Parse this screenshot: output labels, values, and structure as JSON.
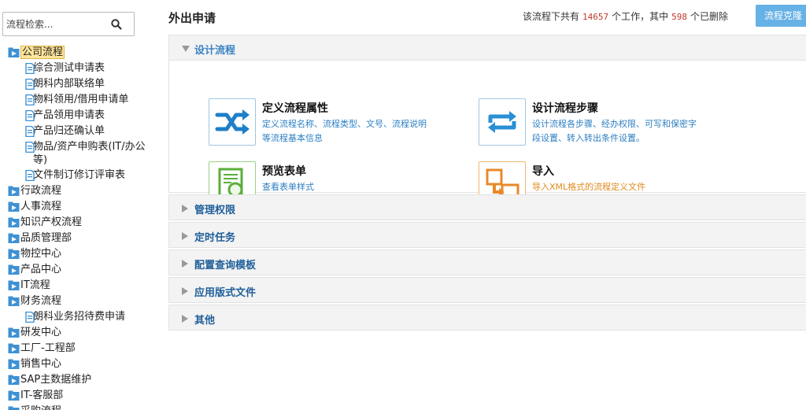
{
  "search": {
    "placeholder": "流程检索..."
  },
  "tree": {
    "root": "公司流程",
    "root_children": [
      "综合测试申请表",
      "朗科内部联络单",
      "物料领用/借用申请单",
      "产品领用申请表",
      "产品归还确认单",
      "物品/资产申购表(IT/办公等)",
      "文件制订修订评审表"
    ],
    "groups_a": [
      "行政流程",
      "人事流程",
      "知识产权流程",
      "品质管理部",
      "物控中心",
      "产品中心",
      "IT流程",
      "财务流程"
    ],
    "finance_child": "朗科业务招待费申请",
    "groups_b": [
      "研发中心",
      "工厂-工程部",
      "销售中心",
      "SAP主数据维护",
      "IT-客服部",
      "采购流程"
    ]
  },
  "header": {
    "title": "外出申请",
    "stats_prefix": "该流程下共有",
    "work_count": "14657",
    "stats_middle": "个工作，其中",
    "deleted_count": "598",
    "stats_suffix": "个已删除",
    "clone_button": "流程克隆"
  },
  "panels": {
    "design": "设计流程",
    "manage": "管理权限",
    "timer": "定时任务",
    "query": "配置查询模板",
    "format": "应用版式文件",
    "other": "其他"
  },
  "cards": {
    "props": {
      "title": "定义流程属性",
      "desc": "定义流程名称、流程类型、文号、流程说明等流程基本信息"
    },
    "steps": {
      "title": "设计流程步骤",
      "desc": "设计流程各步骤、经办权限、可写和保密字段设置、转入转出条件设置。"
    },
    "preview": {
      "title": "预览表单",
      "desc": "查看表单样式"
    },
    "import": {
      "title": "导入",
      "desc": "导入XML格式的流程定义文件"
    }
  },
  "colors": {
    "accent": "#66b1e6",
    "link": "#1f5f99",
    "count": "#c0392b",
    "orange": "#e08a1e"
  }
}
